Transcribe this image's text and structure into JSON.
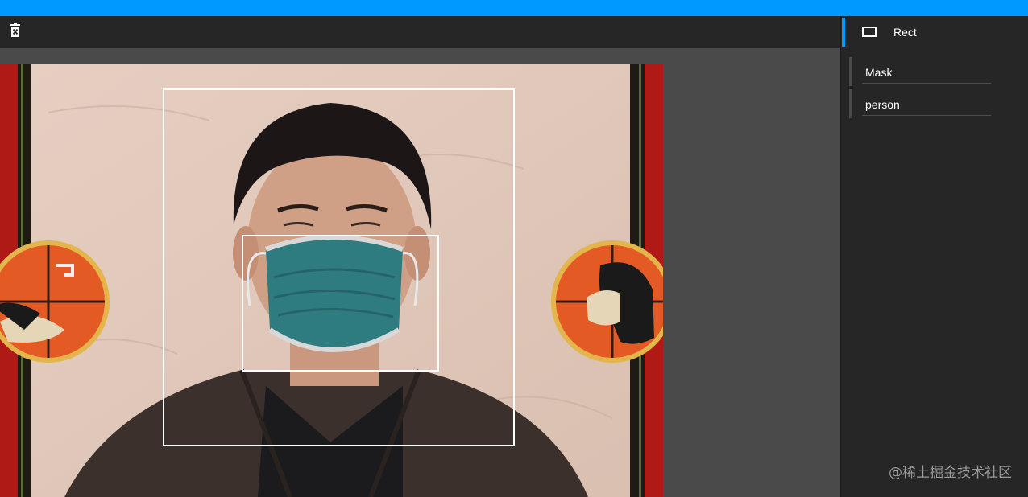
{
  "toolbar": {
    "delete_icon": "trash-icon"
  },
  "sidebar": {
    "tool": {
      "label": "Rect",
      "icon": "rectangle-icon"
    },
    "labels": [
      {
        "label": "Mask"
      },
      {
        "label": "person"
      }
    ]
  },
  "canvas": {
    "annotations": [
      "person",
      "Mask"
    ]
  },
  "watermark": "@稀土掘金技术社区",
  "colors": {
    "accent": "#0099ff",
    "panel": "#262626",
    "canvas_bg": "#4a4a4a",
    "box_stroke": "#ffffff"
  }
}
